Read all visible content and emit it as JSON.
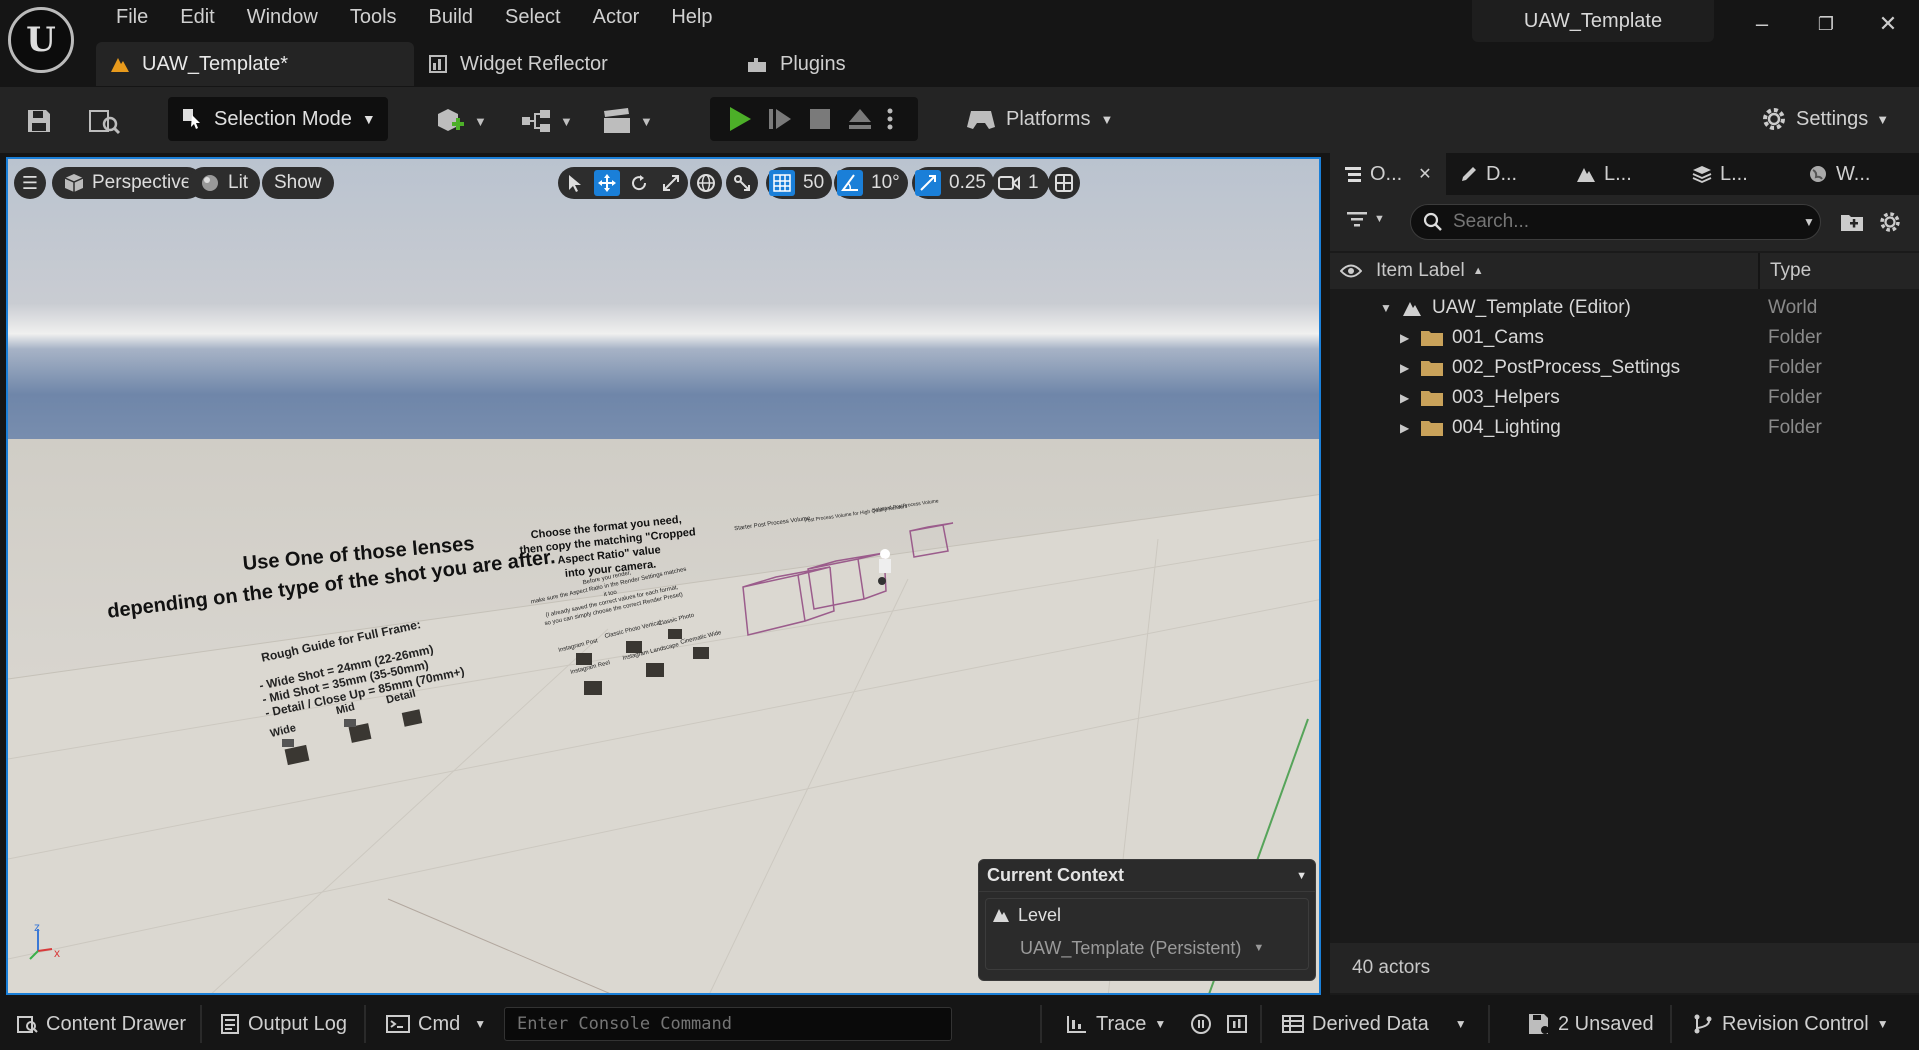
{
  "app": {
    "logo": "U",
    "menu": [
      "File",
      "Edit",
      "Window",
      "Tools",
      "Build",
      "Select",
      "Actor",
      "Help"
    ],
    "document_tab": "UAW_Template*",
    "tabs": [
      "Widget Reflector",
      "Plugins"
    ],
    "project_name": "UAW_Template",
    "window_buttons": {
      "minimize": "–",
      "restore": "❐",
      "close": "✕"
    }
  },
  "toolbar": {
    "mode": "Selection Mode",
    "platforms": "Platforms",
    "settings": "Settings"
  },
  "viewport": {
    "perspective": "Perspective",
    "lit": "Lit",
    "show": "Show",
    "grid_snap": "50",
    "rotation_snap": "10°",
    "scale_snap": "0.25",
    "camera_speed": "1",
    "scene_texts": {
      "lenses_line1": "Use One of those lenses",
      "lenses_line2": "depending on the type of the shot you are after.",
      "guide_title": "Rough Guide for Full Frame:",
      "guide_wide": "- Wide Shot = 24mm (22-26mm)",
      "guide_mid": "- Mid Shot = 35mm (35-50mm)",
      "guide_detail": "- Detail / Close Up = 85mm (70mm+)",
      "cam_wide": "Wide",
      "cam_mid": "Mid",
      "cam_detail": "Detail",
      "format_line1": "Choose the format you need,",
      "format_line2": "then copy the matching \"Cropped Aspect Ratio\" value",
      "format_line3": "into your camera.",
      "render_line1": "Before you render,",
      "render_line2": "make sure the Aspect Ratio in the Render Settings matches it too",
      "render_line3": "(I already saved the correct values for each format,",
      "render_line4": "so you can simply choose the correct Render Preset)",
      "fmt_insta_post": "Instagram Post",
      "fmt_classic_vertical": "Classic Photo Vertical",
      "fmt_classic": "Classic Photo",
      "fmt_insta_reel": "Instagram Reel",
      "fmt_landscape": "Instagram Landscape",
      "fmt_widescreen": "Cinematic Wide",
      "pp_volume": "Starter Post Process Volume",
      "pp_high_quality": "Post Process Volume for High Quality Renders",
      "pp_selection": "Selected PostProcess Volume",
      "axis_z": "z",
      "axis_x": "x"
    },
    "context": {
      "title": "Current Context",
      "level_label": "Level",
      "level_value": "UAW_Template (Persistent)"
    }
  },
  "outliner": {
    "tabs": [
      "O...",
      "D...",
      "L...",
      "L...",
      "W..."
    ],
    "search_placeholder": "Search...",
    "columns": {
      "label": "Item Label",
      "type": "Type"
    },
    "rows": [
      {
        "label": "UAW_Template (Editor)",
        "type": "World"
      },
      {
        "label": "001_Cams",
        "type": "Folder"
      },
      {
        "label": "002_PostProcess_Settings",
        "type": "Folder"
      },
      {
        "label": "003_Helpers",
        "type": "Folder"
      },
      {
        "label": "004_Lighting",
        "type": "Folder"
      }
    ],
    "actor_count": "40 actors"
  },
  "statusbar": {
    "content_drawer": "Content Drawer",
    "output_log": "Output Log",
    "cmd": "Cmd",
    "console_placeholder": "Enter Console Command",
    "trace": "Trace",
    "derived_data": "Derived Data",
    "unsaved": "2 Unsaved",
    "revision_control": "Revision Control"
  },
  "colors": {
    "accent": "#1a7fd8",
    "play": "#4caf28",
    "folder": "#c9a25a"
  }
}
